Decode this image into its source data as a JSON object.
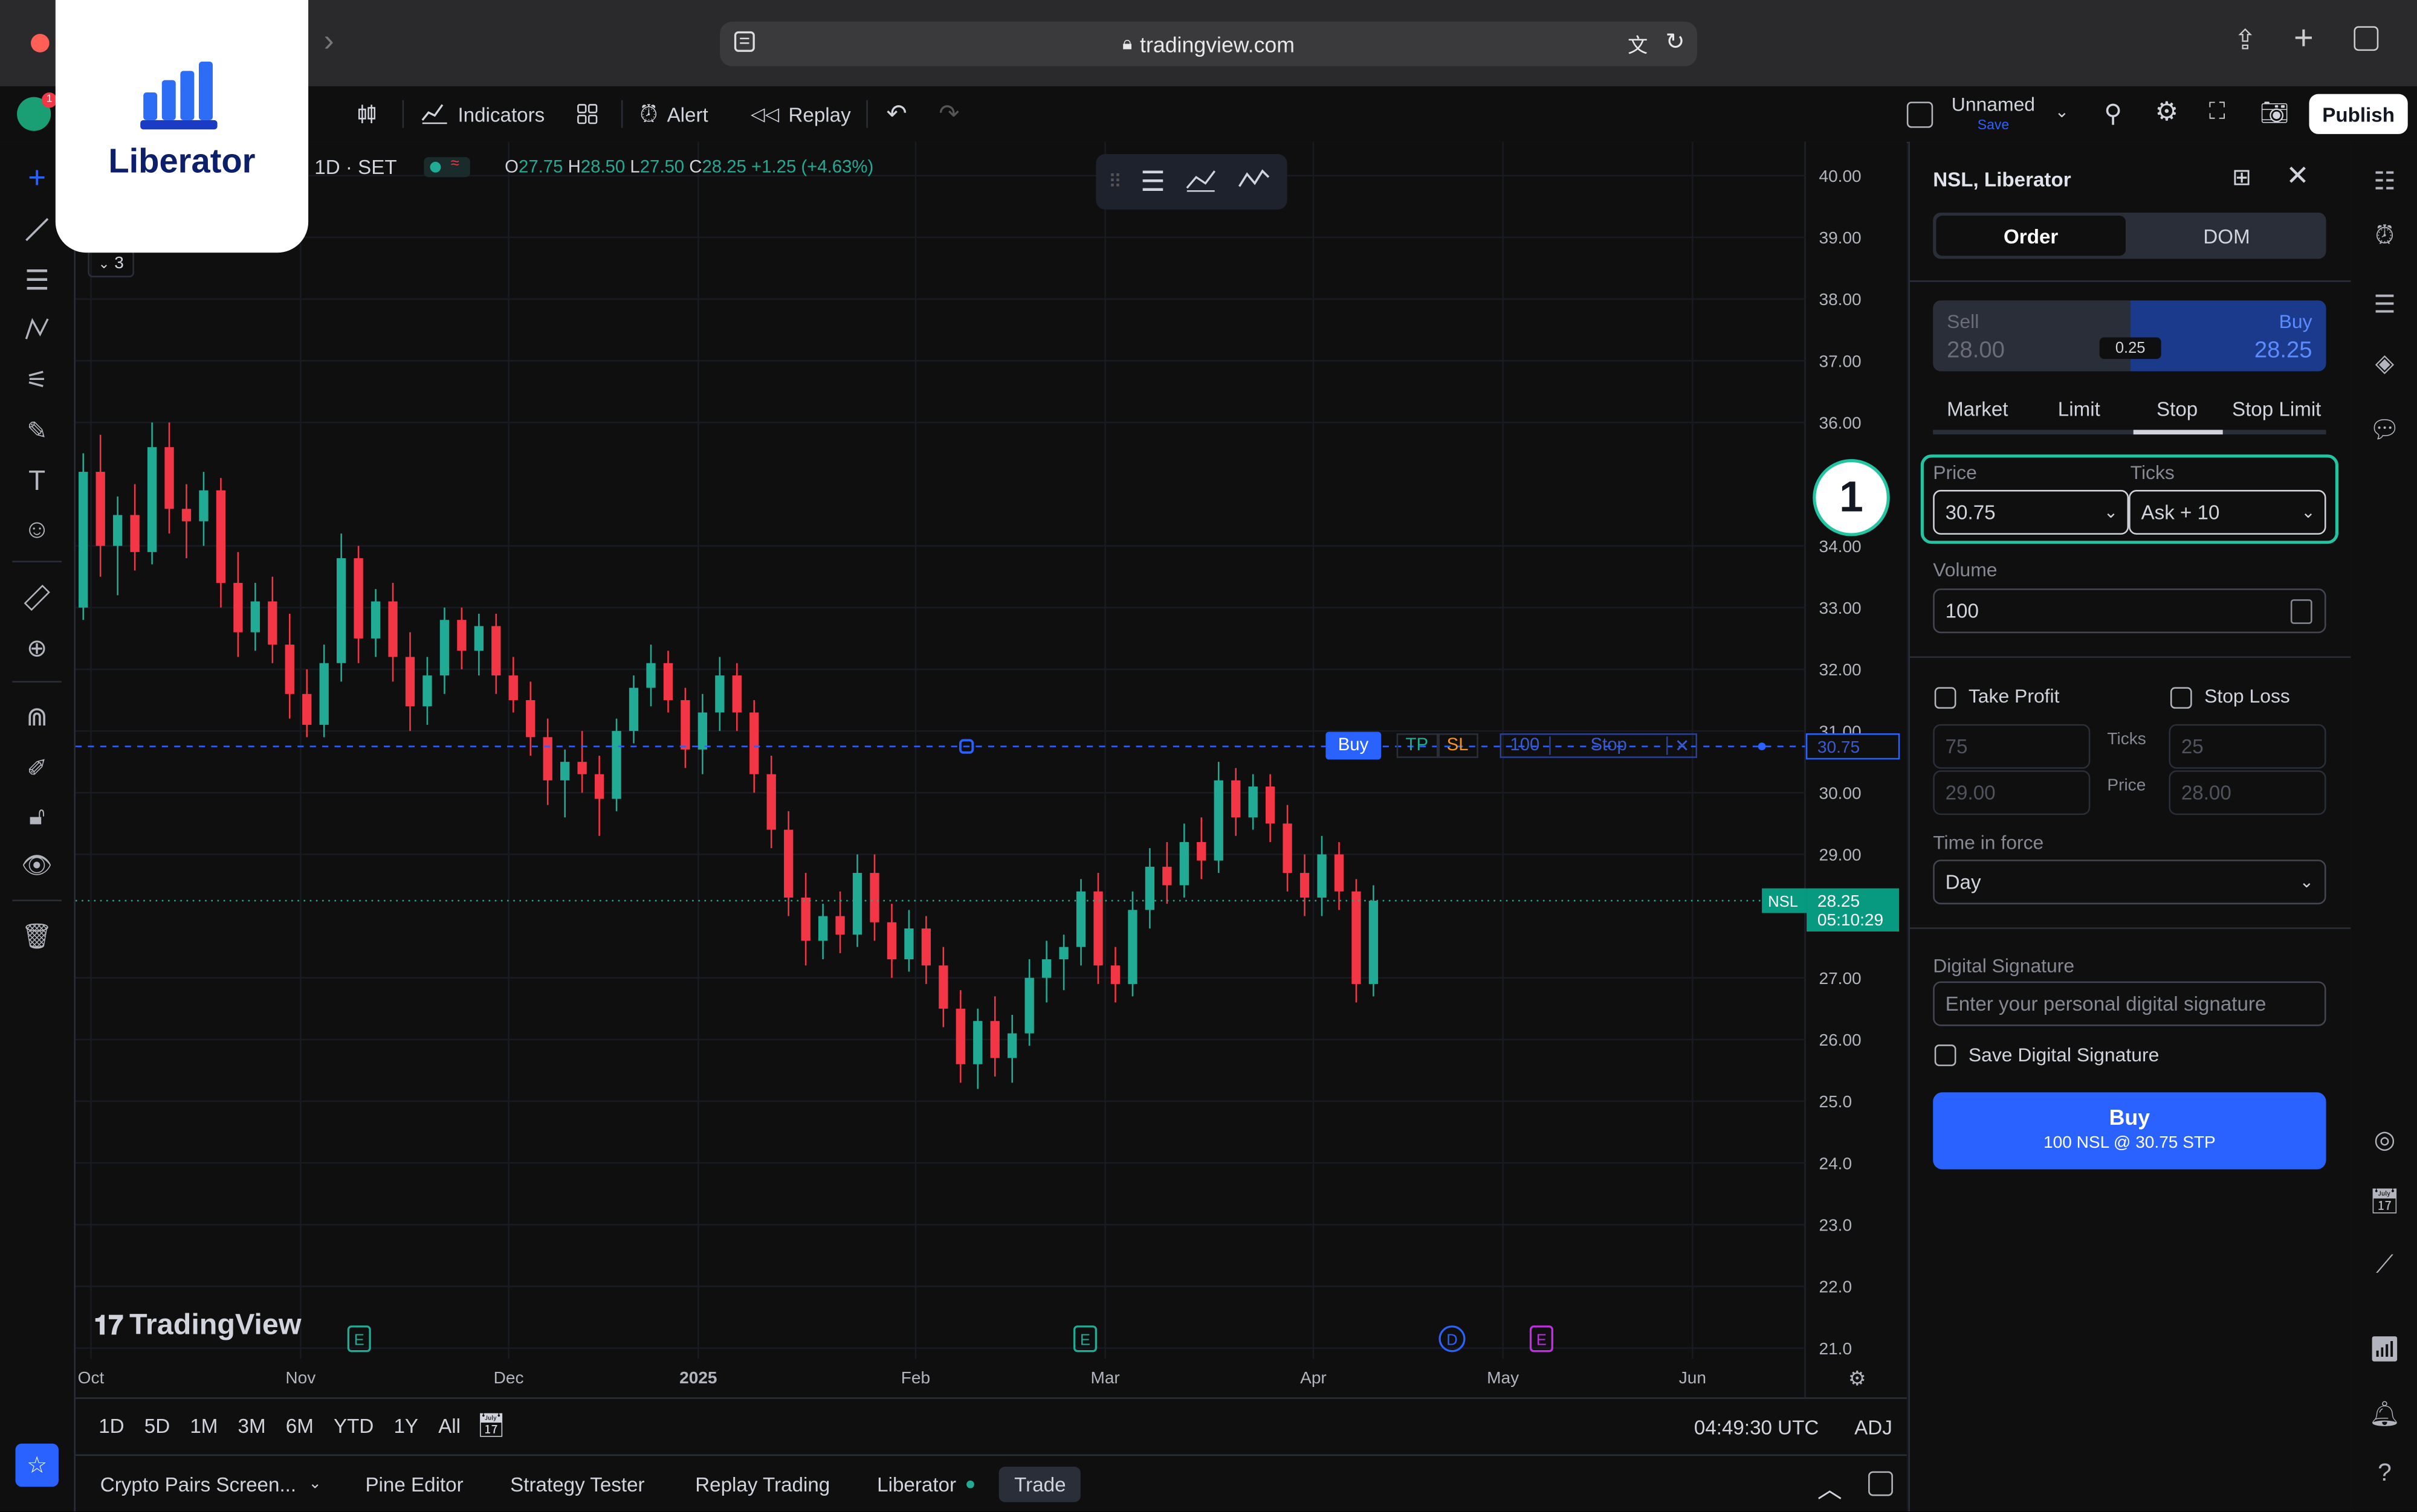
{
  "browser": {
    "url": "tradingview.com"
  },
  "toolbar": {
    "indicators": "Indicators",
    "alert": "Alert",
    "replay": "Replay",
    "layout_name": "Unnamed",
    "layout_save": "Save",
    "publish": "Publish",
    "notification_count": "1"
  },
  "legend": {
    "interval_exchange": "1D · SET",
    "o_label": "O",
    "o_value": "27.75",
    "h_label": "H",
    "h_value": "28.50",
    "l_label": "L",
    "l_value": "27.50",
    "c_label": "C",
    "c_value": "28.25",
    "change": "+1.25 (+4.63%)",
    "indicator_count": "3"
  },
  "brand": {
    "logo_text": "Liberator",
    "watermark": "TradingView"
  },
  "chart_data": {
    "type": "candlestick",
    "symbol": "NSL",
    "ylim": [
      21,
      40
    ],
    "y_ticks": [
      "40.00",
      "39.00",
      "38.00",
      "37.00",
      "36.00",
      "34.00",
      "33.00",
      "32.00",
      "31.00",
      "30.00",
      "29.00",
      "27.00",
      "26.00",
      "25.0",
      "24.0",
      "23.0",
      "22.0",
      "21.0"
    ],
    "x_ticks": [
      "Oct",
      "Nov",
      "Dec",
      "2025",
      "Feb",
      "Mar",
      "Apr",
      "May",
      "Jun"
    ],
    "last_price": "28.25",
    "last_label": "NSL",
    "countdown": "05:10:29",
    "order_price": "30.75",
    "candles": [
      [
        33.0,
        35.5,
        32.8,
        35.2
      ],
      [
        35.2,
        35.8,
        33.5,
        34.0
      ],
      [
        34.0,
        34.8,
        33.2,
        34.5
      ],
      [
        34.5,
        35.0,
        33.6,
        33.9
      ],
      [
        33.9,
        36.0,
        33.7,
        35.6
      ],
      [
        35.6,
        36.0,
        34.2,
        34.6
      ],
      [
        34.6,
        35.0,
        33.8,
        34.4
      ],
      [
        34.4,
        35.2,
        34.0,
        34.9
      ],
      [
        34.9,
        35.1,
        33.0,
        33.4
      ],
      [
        33.4,
        33.9,
        32.2,
        32.6
      ],
      [
        32.6,
        33.4,
        32.3,
        33.1
      ],
      [
        33.1,
        33.5,
        32.1,
        32.4
      ],
      [
        32.4,
        32.9,
        31.2,
        31.6
      ],
      [
        31.6,
        32.0,
        30.9,
        31.1
      ],
      [
        31.1,
        32.4,
        30.9,
        32.1
      ],
      [
        32.1,
        34.2,
        31.8,
        33.8
      ],
      [
        33.8,
        34.0,
        32.1,
        32.5
      ],
      [
        32.5,
        33.3,
        32.2,
        33.1
      ],
      [
        33.1,
        33.4,
        31.8,
        32.2
      ],
      [
        32.2,
        32.6,
        31.0,
        31.4
      ],
      [
        31.4,
        32.2,
        31.1,
        31.9
      ],
      [
        31.9,
        33.0,
        31.6,
        32.8
      ],
      [
        32.8,
        33.0,
        32.0,
        32.3
      ],
      [
        32.3,
        32.9,
        31.9,
        32.7
      ],
      [
        32.7,
        32.9,
        31.6,
        31.9
      ],
      [
        31.9,
        32.2,
        31.3,
        31.5
      ],
      [
        31.5,
        31.8,
        30.6,
        30.9
      ],
      [
        30.9,
        31.2,
        29.8,
        30.2
      ],
      [
        30.2,
        30.7,
        29.6,
        30.5
      ],
      [
        30.5,
        31.0,
        30.0,
        30.3
      ],
      [
        30.3,
        30.6,
        29.3,
        29.9
      ],
      [
        29.9,
        31.2,
        29.7,
        31.0
      ],
      [
        31.0,
        31.9,
        30.8,
        31.7
      ],
      [
        31.7,
        32.4,
        31.4,
        32.1
      ],
      [
        32.1,
        32.3,
        31.3,
        31.5
      ],
      [
        31.5,
        31.7,
        30.4,
        30.7
      ],
      [
        30.7,
        31.6,
        30.3,
        31.3
      ],
      [
        31.3,
        32.2,
        31.0,
        31.9
      ],
      [
        31.9,
        32.1,
        31.0,
        31.3
      ],
      [
        31.3,
        31.5,
        30.0,
        30.3
      ],
      [
        30.3,
        30.6,
        29.1,
        29.4
      ],
      [
        29.4,
        29.7,
        28.0,
        28.3
      ],
      [
        28.3,
        28.7,
        27.2,
        27.6
      ],
      [
        27.6,
        28.2,
        27.3,
        28.0
      ],
      [
        28.0,
        28.4,
        27.4,
        27.7
      ],
      [
        27.7,
        29.0,
        27.5,
        28.7
      ],
      [
        28.7,
        29.0,
        27.6,
        27.9
      ],
      [
        27.9,
        28.2,
        27.0,
        27.3
      ],
      [
        27.3,
        28.1,
        27.1,
        27.8
      ],
      [
        27.8,
        28.0,
        26.9,
        27.2
      ],
      [
        27.2,
        27.5,
        26.2,
        26.5
      ],
      [
        26.5,
        26.8,
        25.3,
        25.6
      ],
      [
        25.6,
        26.5,
        25.2,
        26.3
      ],
      [
        26.3,
        26.7,
        25.4,
        25.7
      ],
      [
        25.7,
        26.4,
        25.3,
        26.1
      ],
      [
        26.1,
        27.3,
        25.9,
        27.0
      ],
      [
        27.0,
        27.6,
        26.6,
        27.3
      ],
      [
        27.3,
        27.7,
        26.8,
        27.5
      ],
      [
        27.5,
        28.6,
        27.2,
        28.4
      ],
      [
        28.4,
        28.7,
        26.9,
        27.2
      ],
      [
        27.2,
        27.5,
        26.6,
        26.9
      ],
      [
        26.9,
        28.4,
        26.7,
        28.1
      ],
      [
        28.1,
        29.1,
        27.8,
        28.8
      ],
      [
        28.8,
        29.2,
        28.2,
        28.5
      ],
      [
        28.5,
        29.5,
        28.3,
        29.2
      ],
      [
        29.2,
        29.6,
        28.6,
        28.9
      ],
      [
        28.9,
        30.5,
        28.7,
        30.2
      ],
      [
        30.2,
        30.4,
        29.3,
        29.6
      ],
      [
        29.6,
        30.3,
        29.4,
        30.1
      ],
      [
        30.1,
        30.3,
        29.2,
        29.5
      ],
      [
        29.5,
        29.8,
        28.4,
        28.7
      ],
      [
        28.7,
        29.0,
        28.0,
        28.3
      ],
      [
        28.3,
        29.3,
        28.0,
        29.0
      ],
      [
        29.0,
        29.2,
        28.1,
        28.4
      ],
      [
        28.4,
        28.6,
        26.6,
        26.9
      ],
      [
        26.9,
        28.5,
        26.7,
        28.25
      ]
    ]
  },
  "order_line": {
    "side": "Buy",
    "tp": "TP",
    "sl": "SL",
    "qty": "100",
    "type": "Stop",
    "close": "✕",
    "price": "30.75"
  },
  "earnings_markers": [
    "E",
    "E",
    "D",
    "E"
  ],
  "timebar": {
    "ranges": [
      "1D",
      "5D",
      "1M",
      "3M",
      "6M",
      "YTD",
      "1Y",
      "All"
    ],
    "clock": "04:49:30 UTC",
    "adj": "ADJ"
  },
  "bottom_tabs": [
    "Crypto Pairs Screen...",
    "Pine Editor",
    "Strategy Tester",
    "Replay Trading",
    "Liberator",
    "Trade"
  ],
  "panel": {
    "title": "NSL, Liberator",
    "tabs": [
      "Order",
      "DOM"
    ],
    "sell_label": "Sell",
    "sell_price": "28.00",
    "spread": "0.25",
    "buy_label": "Buy",
    "buy_price": "28.25",
    "order_types": [
      "Market",
      "Limit",
      "Stop",
      "Stop Limit"
    ],
    "price_label": "Price",
    "price_value": "30.75",
    "ticks_label": "Ticks",
    "ticks_value": "Ask + 10",
    "step_badge": "1",
    "volume_label": "Volume",
    "volume_value": "100",
    "take_profit": "Take Profit",
    "stop_loss": "Stop Loss",
    "tp_ticks": "75",
    "tp_price": "29.00",
    "sl_ticks": "25",
    "sl_price": "28.00",
    "mid_ticks": "Ticks",
    "mid_price": "Price",
    "tif_label": "Time in force",
    "tif_value": "Day",
    "sig_label": "Digital Signature",
    "sig_placeholder": "Enter your personal digital signature",
    "save_sig": "Save Digital Signature",
    "buy_button": "Buy",
    "buy_button_sub": "100 NSL @ 30.75 STP"
  }
}
